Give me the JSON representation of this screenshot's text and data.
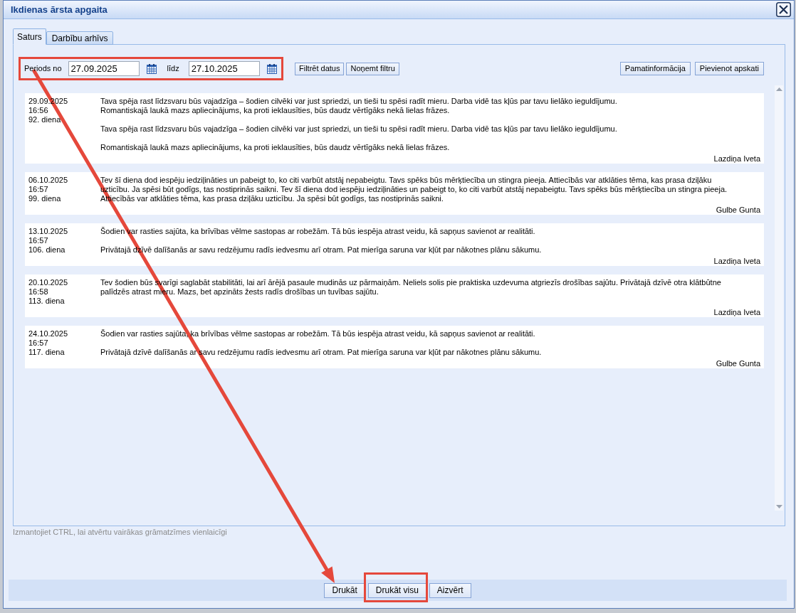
{
  "window": {
    "title": "Ikdienas ārsta apgaita"
  },
  "tabs": [
    {
      "label": "Saturs",
      "selected": true
    },
    {
      "label": "Darbību arhīvs",
      "selected": false
    }
  ],
  "filter": {
    "from_label": "Periods no",
    "from_value": "27.09.2025",
    "to_label": "līdz",
    "to_value": "27.10.2025",
    "highlighted": true,
    "buttons": [
      "Filtrēt datus",
      "Noņemt filtru"
    ]
  },
  "actions": [
    "Pamatinformācija",
    "Pievienot apskati"
  ],
  "entries": [
    {
      "date": "29.09.2025",
      "time": "16:56",
      "day": "92. diena",
      "paragraphs": [
        [
          "Tava spēja rast līdzsvaru būs vajadzīga – šodien cilvēki var just spriedzi, un tieši tu spēsi radīt mieru. Darba vidē tas kļūs par tavu lielāko ieguldījumu.",
          "Romantiskajā laukā mazs apliecinājums, ka proti ieklausīties, būs daudz vērtīgāks nekā lielas frāzes."
        ],
        [
          "Tava spēja rast līdzsvaru būs vajadzīga – šodien cilvēki var just spriedzi, un tieši tu spēsi radīt mieru. Darba vidē tas kļūs par tavu lielāko ieguldījumu."
        ],
        [
          "Romantiskajā laukā mazs apliecinājums, ka proti ieklausīties, būs daudz vērtīgāks nekā lielas frāzes."
        ]
      ],
      "author": "Lazdiņa Iveta"
    },
    {
      "date": "06.10.2025",
      "time": "16:57",
      "day": "99. diena",
      "paragraphs": [
        [
          "Tev šī diena dod iespēju iedziļināties un pabeigt to, ko citi varbūt atstāj nepabeigtu. Tavs spēks būs mērķtiecība un stingra pieeja. Attiecībās var atklāties tēma, kas prasa dziļāku uzticību. Ja spēsi būt godīgs, tas nostiprinās saikni. Tev šī diena dod iespēju iedziļināties un pabeigt to, ko citi varbūt atstāj nepabeigtu. Tavs spēks būs mērķtiecība un stingra pieeja. Attiecībās var atklāties tēma, kas prasa dziļāku uzticību. Ja spēsi būt godīgs, tas nostiprinās saikni."
        ]
      ],
      "author": "Gulbe Gunta"
    },
    {
      "date": "13.10.2025",
      "time": "16:57",
      "day": "106. diena",
      "paragraphs": [
        [
          "Šodien var rasties sajūta, ka brīvības vēlme sastopas ar robežām. Tā būs iespēja atrast veidu, kā sapņus savienot ar realitāti."
        ],
        [
          "Privātajā dzīvē dalīšanās ar savu redzējumu radīs iedvesmu arī otram. Pat mierīga saruna var kļūt par nākotnes plānu sākumu."
        ]
      ],
      "author": "Lazdiņa Iveta"
    },
    {
      "date": "20.10.2025",
      "time": "16:58",
      "day": "113. diena",
      "paragraphs": [
        [
          "Tev šodien būs svarīgi saglabāt stabilitāti, lai arī ārējā pasaule mudinās uz pārmaiņām. Neliels solis pie praktiska uzdevuma atgriezīs drošības sajūtu. Privātajā dzīvē otra klātbūtne palīdzēs atrast mieru. Mazs, bet apzināts žests radīs drošības un tuvības sajūtu."
        ]
      ],
      "author": "Lazdiņa Iveta"
    },
    {
      "date": "24.10.2025",
      "time": "16:57",
      "day": "117. diena",
      "paragraphs": [
        [
          "Šodien var rasties sajūta, ka brīvības vēlme sastopas ar robežām. Tā būs iespēja atrast veidu, kā sapņus savienot ar realitāti."
        ],
        [
          "Privātajā dzīvē dalīšanās ar savu redzējumu radīs iedvesmu arī otram. Pat mierīga saruna var kļūt par nākotnes plānu sākumu."
        ]
      ],
      "author": "Gulbe Gunta"
    }
  ],
  "hint": "Izmantojiet CTRL, lai atvērtu vairākas grāmatzīmes vienlaicīgi",
  "footer_buttons": [
    {
      "label": "Drukāt",
      "highlighted": false
    },
    {
      "label": "Drukāt visu",
      "highlighted": true
    },
    {
      "label": "Aizvērt",
      "highlighted": false
    }
  ],
  "annotation_arrow": true
}
